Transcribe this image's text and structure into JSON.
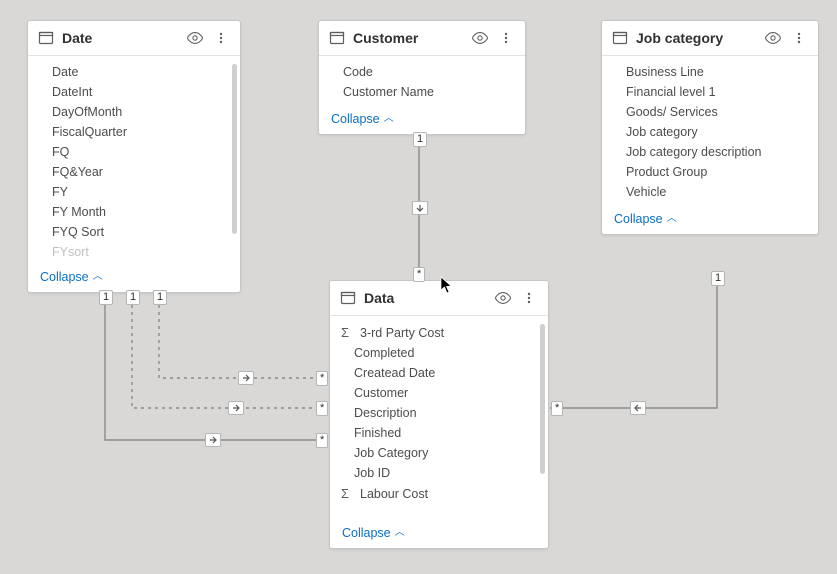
{
  "collapse_label": "Collapse",
  "tables": {
    "date": {
      "title": "Date",
      "fields": [
        "Date",
        "DateInt",
        "DayOfMonth",
        "FiscalQuarter",
        "FQ",
        "FQ&Year",
        "FY",
        "FY Month",
        "FYQ Sort",
        "FYsort"
      ]
    },
    "customer": {
      "title": "Customer",
      "fields": [
        "Code",
        "Customer Name"
      ]
    },
    "jobcat": {
      "title": "Job category",
      "fields": [
        "Business Line",
        "Financial level 1",
        "Goods/ Services",
        "Job category",
        "Job category description",
        "Product Group",
        "Vehicle"
      ]
    },
    "data": {
      "title": "Data",
      "fields": [
        {
          "label": "3-rd Party Cost",
          "sigma": true
        },
        {
          "label": "Completed"
        },
        {
          "label": "Createad Date"
        },
        {
          "label": "Customer"
        },
        {
          "label": "Description"
        },
        {
          "label": "Finished"
        },
        {
          "label": "Job Category"
        },
        {
          "label": "Job ID"
        },
        {
          "label": "Labour Cost",
          "sigma": true
        }
      ]
    }
  },
  "cardinality": {
    "one": "1",
    "many": "*"
  }
}
